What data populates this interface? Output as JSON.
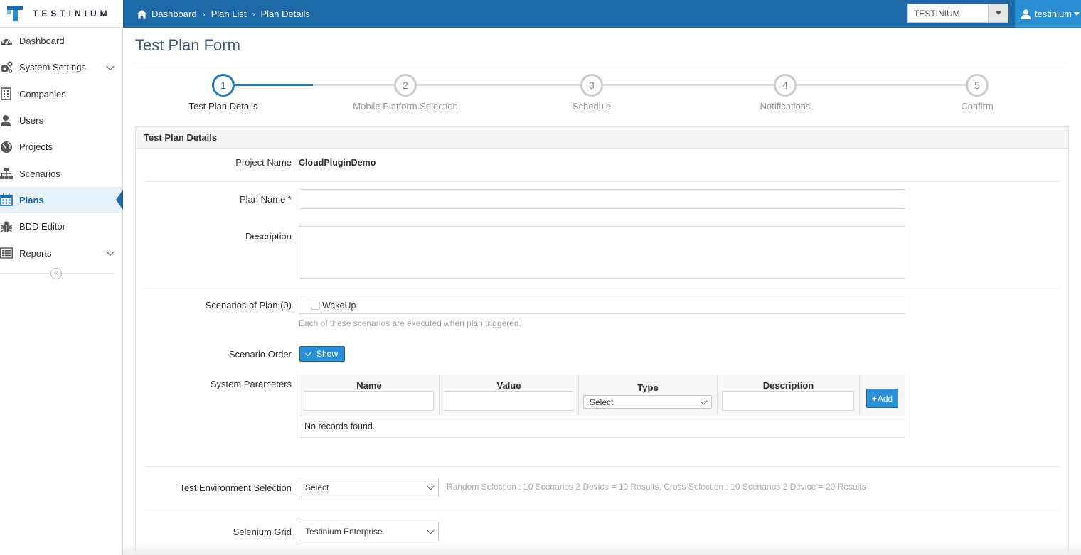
{
  "brand": {
    "name": "TESTINIUM"
  },
  "breadcrumb": {
    "items": [
      "Dashboard",
      "Plan List",
      "Plan Details"
    ]
  },
  "header": {
    "company_select": "TESTINIUM",
    "user_name": "testinium"
  },
  "sidebar": {
    "items": [
      {
        "label": "Dashboard",
        "icon": "dashboard-icon"
      },
      {
        "label": "System Settings",
        "icon": "gears-icon",
        "expandable": true
      },
      {
        "label": "Companies",
        "icon": "building-icon"
      },
      {
        "label": "Users",
        "icon": "user-icon"
      },
      {
        "label": "Projects",
        "icon": "globe-icon"
      },
      {
        "label": "Scenarios",
        "icon": "sitemap-icon"
      },
      {
        "label": "Plans",
        "icon": "calendar-icon",
        "active": true
      },
      {
        "label": "BDD Editor",
        "icon": "bug-icon"
      },
      {
        "label": "Reports",
        "icon": "list-icon",
        "expandable": true
      }
    ],
    "collapse_glyph": "«"
  },
  "page": {
    "title": "Test Plan Form"
  },
  "wizard": {
    "steps": [
      {
        "number": "1",
        "label": "Test Plan Details",
        "active": true
      },
      {
        "number": "2",
        "label": "Mobile Platform Selection"
      },
      {
        "number": "3",
        "label": "Schedule"
      },
      {
        "number": "4",
        "label": "Notifications"
      },
      {
        "number": "5",
        "label": "Confirm"
      }
    ],
    "accent_color": "#2a7ab8"
  },
  "form": {
    "panel_title": "Test Plan Details",
    "project_name_label": "Project Name",
    "project_name_value": "CloudPluginDemo",
    "plan_name_label": "Plan Name *",
    "plan_name_value": "",
    "description_label": "Description",
    "description_value": "",
    "scenarios_label": "Scenarios of Plan (0)",
    "scenario_option": "WakeUp",
    "scenarios_help": "Each of these scenarios are executed when plan triggered.",
    "scenario_order_label": "Scenario Order",
    "scenario_order_button": "Show",
    "system_params_label": "System Parameters",
    "params_columns": [
      "Name",
      "Value",
      "Type",
      "Description"
    ],
    "params_type_select": "Select",
    "params_add_button": "Add",
    "params_empty": "No records found.",
    "test_env_label": "Test Environment Selection",
    "test_env_select": "Select",
    "test_env_help": "Random Selection : 10 Scenarios 2 Device = 10 Results, Cross Selection : 10 Scenarios 2 Device = 20 Results",
    "selenium_grid_label": "Selenium Grid",
    "selenium_grid_select": "Testinium Enterprise"
  }
}
